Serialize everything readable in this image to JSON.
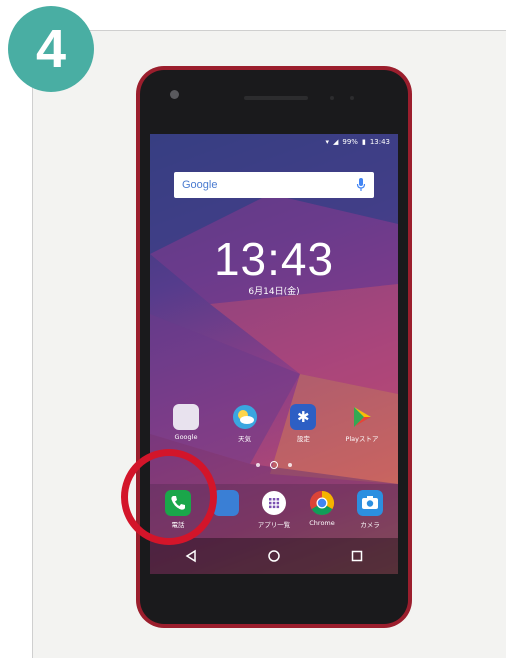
{
  "step": {
    "number": "4"
  },
  "status_bar": {
    "battery": "99%",
    "time": "13:43"
  },
  "search": {
    "logo": "Google"
  },
  "clock": {
    "time": "13:43",
    "date": "6月14日(金)"
  },
  "home_apps": [
    {
      "label": "Google",
      "icon": "google-folder-icon"
    },
    {
      "label": "天気",
      "icon": "weather-icon"
    },
    {
      "label": "設定",
      "icon": "settings-icon"
    },
    {
      "label": "Playストア",
      "icon": "play-store-icon"
    }
  ],
  "dock_apps": [
    {
      "label": "電話",
      "icon": "phone-icon"
    },
    {
      "label": "",
      "icon": "messages-icon"
    },
    {
      "label": "アプリ一覧",
      "icon": "app-drawer-icon"
    },
    {
      "label": "Chrome",
      "icon": "chrome-icon"
    },
    {
      "label": "カメラ",
      "icon": "camera-icon"
    }
  ],
  "colors": {
    "badge": "#49aea3",
    "phone_body": "#9b1e2d",
    "highlight_ring": "#d3152a",
    "phone_app": "#1aa64a"
  }
}
